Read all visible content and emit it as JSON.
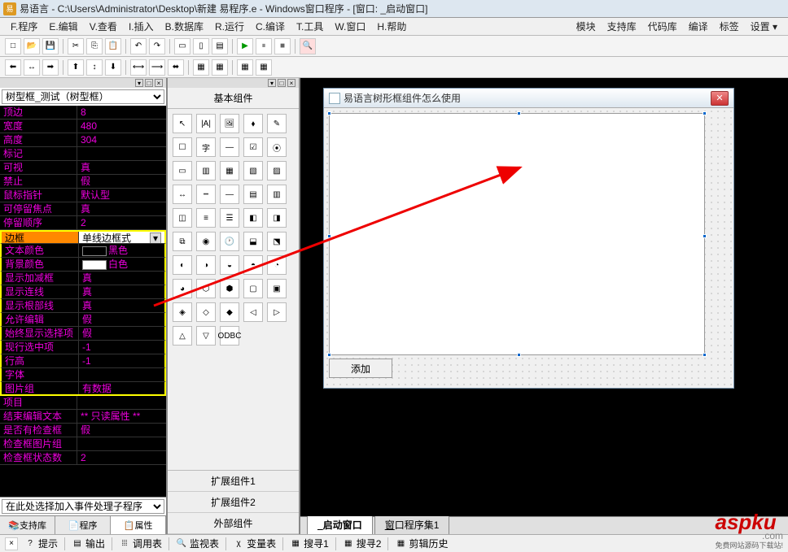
{
  "titlebar": {
    "icon_text": "易",
    "text": "易语言 - C:\\Users\\Administrator\\Desktop\\新建 易程序.e - Windows窗口程序 - [窗口: _启动窗口]"
  },
  "menubar": {
    "items": [
      "F.程序",
      "E.编辑",
      "V.查看",
      "I.插入",
      "B.数据库",
      "R.运行",
      "C.编译",
      "T.工具",
      "W.窗口",
      "H.帮助"
    ],
    "right_items": [
      "模块",
      "支持库",
      "代码库",
      "编译",
      "标签",
      "设置 ▾"
    ]
  },
  "left": {
    "combo_value": "树型框_测试（树型框）",
    "props": [
      {
        "name": "顶边",
        "val": "8"
      },
      {
        "name": "宽度",
        "val": "480"
      },
      {
        "name": "高度",
        "val": "304"
      },
      {
        "name": "标记",
        "val": ""
      },
      {
        "name": "可视",
        "val": "真"
      },
      {
        "name": "禁止",
        "val": "假"
      },
      {
        "name": "鼠标指针",
        "val": "默认型"
      },
      {
        "name": "可停留焦点",
        "val": "真"
      },
      {
        "name": "停留顺序",
        "val": "2"
      },
      {
        "name": "边框",
        "val": "单线边框式",
        "sel": true
      },
      {
        "name": "文本颜色",
        "val": "黑色",
        "swatch": "#000"
      },
      {
        "name": "背景颜色",
        "val": "白色",
        "swatch": "#fff"
      },
      {
        "name": "显示加减框",
        "val": "真"
      },
      {
        "name": "显示连线",
        "val": "真"
      },
      {
        "name": "显示根部线",
        "val": "真"
      },
      {
        "name": "允许编辑",
        "val": "假"
      },
      {
        "name": "始终显示选择项",
        "val": "假"
      },
      {
        "name": "现行选中项",
        "val": "-1"
      },
      {
        "name": "行高",
        "val": "-1"
      },
      {
        "name": "字体",
        "val": ""
      },
      {
        "name": "图片组",
        "val": "有数据"
      },
      {
        "name": "项目",
        "val": ""
      },
      {
        "name": "结束编辑文本",
        "val": "** 只读属性 **"
      },
      {
        "name": "是否有检查框",
        "val": "假"
      },
      {
        "name": "检查框图片组",
        "val": ""
      },
      {
        "name": "检查框状态数",
        "val": "2"
      }
    ],
    "yellow_start": 9,
    "yellow_end": 20,
    "event_combo": "在此处选择加入事件处理子程序",
    "tabs": [
      {
        "icon": "📚",
        "label": "支持库"
      },
      {
        "icon": "📄",
        "label": "程序"
      },
      {
        "icon": "📋",
        "label": "属性",
        "active": true
      }
    ]
  },
  "mid": {
    "title": "基本组件",
    "palette_count": 48,
    "palette_captions": [
      "↖",
      "|A|",
      "🖼",
      "⬧",
      "✎",
      "☐",
      "字",
      "—",
      "☑",
      "⦿",
      "▭",
      "▥",
      "▦",
      "▧",
      "▨",
      "↔",
      "┅",
      "—",
      "▤",
      "▥",
      "◫",
      "≡",
      "☰",
      "◧",
      "◨",
      "⧉",
      "◉",
      "🕐",
      "⬓",
      "⬔",
      "◐",
      "◑",
      "◒",
      "◓",
      "◔",
      "◕",
      "⬡",
      "⬢",
      "▢",
      "▣",
      "◈",
      "◇",
      "◆",
      "◁",
      "▷",
      "△",
      "▽",
      "ODBC"
    ],
    "tabs": [
      "扩展组件1",
      "扩展组件2",
      "外部组件"
    ]
  },
  "form": {
    "title": "易语言树形框组件怎么使用",
    "add_button": "添加"
  },
  "designer_tabs": [
    {
      "label": "_启动窗口",
      "active": true
    },
    {
      "label": "窗口程序集1"
    }
  ],
  "bottom": {
    "items": [
      {
        "icon": "?",
        "label": "提示"
      },
      {
        "icon": "▤",
        "label": "输出"
      },
      {
        "icon": "⦙⦙⦙",
        "label": "调用表"
      },
      {
        "icon": "🔍",
        "label": "监视表"
      },
      {
        "icon": "χ",
        "label": "变量表"
      },
      {
        "icon": "▦",
        "label": "搜寻1"
      },
      {
        "icon": "▦",
        "label": "搜寻2"
      },
      {
        "icon": "▦",
        "label": "剪辑历史"
      }
    ]
  },
  "watermark": {
    "main": "aspku",
    "dom": ".com",
    "sub": "免费网站源码下载站!"
  }
}
